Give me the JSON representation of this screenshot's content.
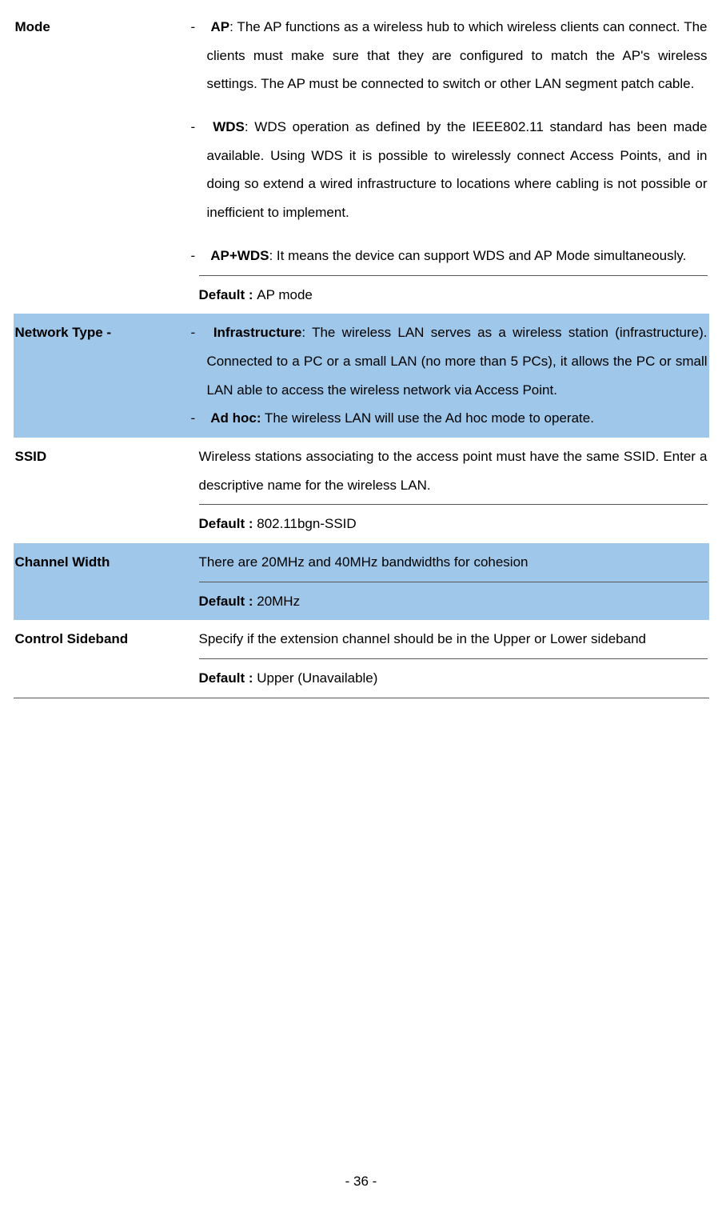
{
  "rows": {
    "mode": {
      "label": "Mode",
      "ap_bold": "AP",
      "ap_rest": ": The AP functions as a wireless hub to which wireless clients can connect. The clients must make sure that they are configured to match the AP's wireless settings. The AP must be connected to switch or other LAN segment patch cable.",
      "wds_bold": "WDS",
      "wds_rest": ":  WDS operation as defined by the IEEE802.11 standard has been made available. Using WDS it is possible to wirelessly connect Access Points, and in doing so extend a wired infrastructure to locations where cabling is not possible or inefficient to implement.",
      "apwds_bold": "AP+WDS",
      "apwds_rest": ": It means the device can support WDS and AP Mode simultaneously.",
      "default_label": "Default : ",
      "default_val": "AP mode"
    },
    "network": {
      "label": "Network Type -",
      "infra_bold": "Infrastructure",
      "infra_rest": ": The wireless LAN serves as a wireless station (infrastructure). Connected to a PC or a small LAN (no more than 5 PCs), it allows the PC or small LAN able to access the wireless network via Access Point.",
      "adhoc_bold": "Ad hoc:",
      "adhoc_rest": " The wireless LAN will use the Ad hoc mode to operate."
    },
    "ssid": {
      "label": "SSID",
      "desc": "Wireless stations associating to the access point must have the same SSID. Enter a descriptive name for the wireless LAN.",
      "default_label": "Default : ",
      "default_val": "802.11bgn-SSID"
    },
    "chwidth": {
      "label": "Channel Width",
      "desc": "There are 20MHz and 40MHz bandwidths for cohesion",
      "default_label": "Default : ",
      "default_val": "20MHz"
    },
    "sideband": {
      "label": "Control Sideband",
      "desc": "Specify if the extension channel should be in the Upper or Lower sideband",
      "default_label": "Default : ",
      "default_val": "Upper (Unavailable)"
    }
  },
  "page_number": "- 36 -"
}
